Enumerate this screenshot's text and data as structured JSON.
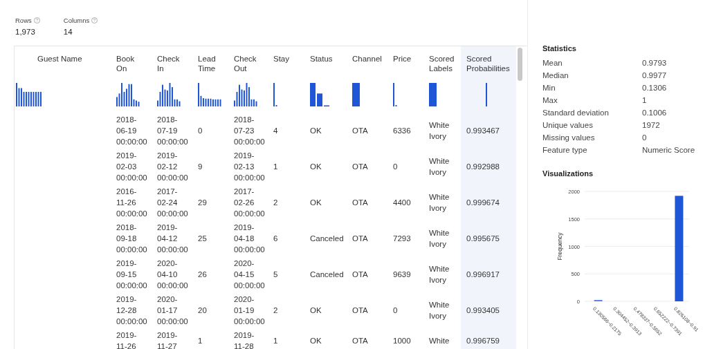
{
  "summary": [
    {
      "label": "Rows",
      "value": "1,973"
    },
    {
      "label": "Columns",
      "value": "14"
    }
  ],
  "table": {
    "columns": [
      {
        "label": "Guest Name",
        "selected": false
      },
      {
        "label": "Book On",
        "selected": false
      },
      {
        "label": "Check In",
        "selected": false
      },
      {
        "label": "Lead Time",
        "selected": false
      },
      {
        "label": "Check Out",
        "selected": false
      },
      {
        "label": "Stay",
        "selected": false
      },
      {
        "label": "Status",
        "selected": false
      },
      {
        "label": "Channel",
        "selected": false
      },
      {
        "label": "Price",
        "selected": false
      },
      {
        "label": "Scored Labels",
        "selected": false
      },
      {
        "label": "Scored Probabilities",
        "selected": true
      }
    ],
    "rows": [
      {
        "cells": [
          "",
          "2018-06-19 00:00:00",
          "2018-07-19 00:00:00",
          "0",
          "2018-07-23 00:00:00",
          "4",
          "OK",
          "OTA",
          "6336",
          "White Ivory",
          "0.993467"
        ]
      },
      {
        "cells": [
          "",
          "2019-02-03 00:00:00",
          "2019-02-12 00:00:00",
          "9",
          "2019-02-13 00:00:00",
          "1",
          "OK",
          "OTA",
          "0",
          "White Ivory",
          "0.992988"
        ]
      },
      {
        "cells": [
          "",
          "2016-11-26 00:00:00",
          "2017-02-24 00:00:00",
          "29",
          "2017-02-26 00:00:00",
          "2",
          "OK",
          "OTA",
          "4400",
          "White Ivory",
          "0.999674"
        ]
      },
      {
        "cells": [
          "",
          "2018-09-18 00:00:00",
          "2019-04-12 00:00:00",
          "25",
          "2019-04-18 00:00:00",
          "6",
          "Canceled",
          "OTA",
          "7293",
          "White Ivory",
          "0.995675"
        ]
      },
      {
        "cells": [
          "",
          "2019-09-15 00:00:00",
          "2020-04-10 00:00:00",
          "26",
          "2020-04-15 00:00:00",
          "5",
          "Canceled",
          "OTA",
          "9639",
          "White Ivory",
          "0.996917"
        ]
      },
      {
        "cells": [
          "",
          "2019-12-28 00:00:00",
          "2020-01-17 00:00:00",
          "20",
          "2020-01-19 00:00:00",
          "2",
          "OK",
          "OTA",
          "0",
          "White Ivory",
          "0.993405"
        ]
      },
      {
        "cells": [
          "",
          "2019-11-26",
          "2019-11-27",
          "1",
          "2019-11-28",
          "1",
          "OK",
          "OTA",
          "1000",
          "White",
          "0.996759"
        ]
      }
    ]
  },
  "statistics": {
    "title": "Statistics",
    "items": [
      {
        "label": "Mean",
        "value": "0.9793"
      },
      {
        "label": "Median",
        "value": "0.9977"
      },
      {
        "label": "Min",
        "value": "0.1306"
      },
      {
        "label": "Max",
        "value": "1"
      },
      {
        "label": "Standard deviation",
        "value": "0.1006"
      },
      {
        "label": "Unique values",
        "value": "1972"
      },
      {
        "label": "Missing values",
        "value": "0"
      },
      {
        "label": "Feature type",
        "value": "Numeric Score"
      }
    ]
  },
  "visualizations": {
    "title": "Visualizations",
    "chart_data": {
      "type": "bar",
      "ylabel": "Frequency",
      "categories": [
        "0.130566~0.2175",
        "0.304452~0.3913",
        "0.478337~0.5652",
        "0.652222~0.7391",
        "0.826108~0.91"
      ],
      "grid": true,
      "values": [
        20,
        0,
        0,
        0,
        1920
      ],
      "ylim": [
        0,
        2000
      ],
      "yticks": [
        0,
        500,
        1000,
        1500,
        2000
      ]
    }
  }
}
